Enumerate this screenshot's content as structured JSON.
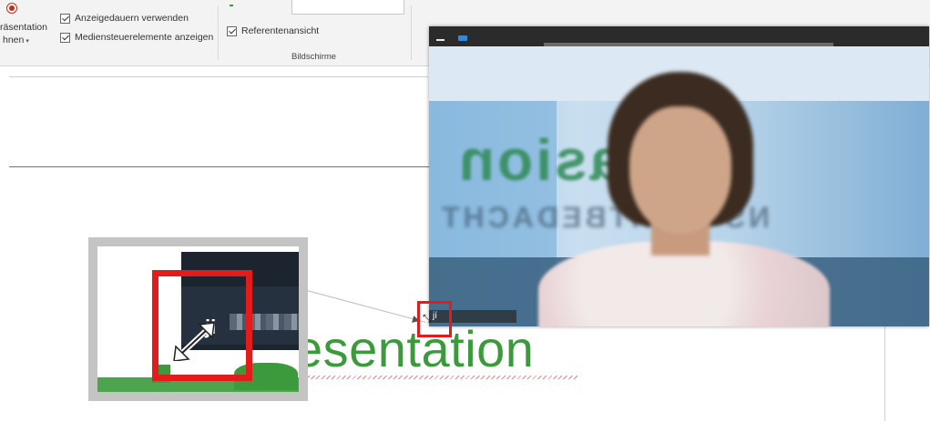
{
  "ribbon": {
    "record_label_line1": "räsentation",
    "record_label_line2": "hnen",
    "checkbox_timings": "Anzeigedauern verwenden",
    "checkbox_media_controls": "Mediensteuerelemente anzeigen",
    "checkbox_presenter_view": "Referentenansicht",
    "group_label": "Bildschirme"
  },
  "slide": {
    "title_fragment": "esentation"
  },
  "video": {
    "banner_text": "metasion",
    "sub_banner_text": "NS LICHTBEDACHT",
    "name_label": "jí"
  },
  "magnifier": {
    "cursor_text": "ji"
  }
}
